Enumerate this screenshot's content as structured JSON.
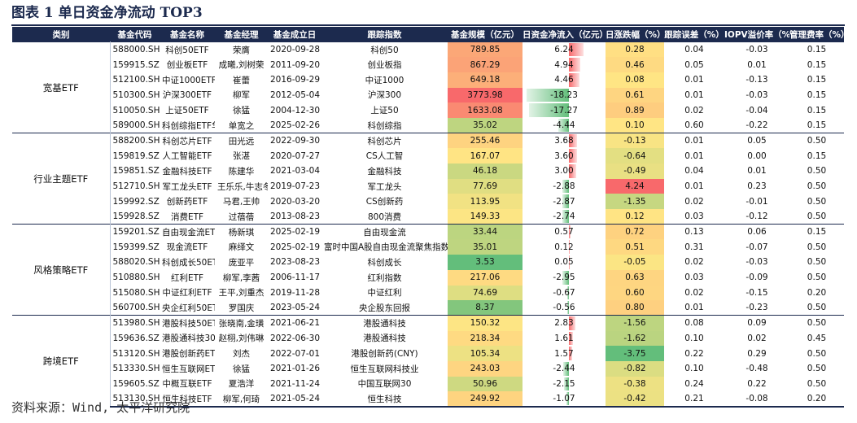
{
  "title": "图表 1  单日资金净流动 TOP3",
  "source": "资料来源：Wind, 太平洋研究院",
  "columns": [
    "类别",
    "基金代码",
    "基金名称",
    "基金经理",
    "基金成立日",
    "跟踪指数",
    "基金规模（亿元）",
    "日资金净流入（亿元）",
    "日涨跌幅（%）",
    "跟踪误差（%）",
    "IOPV溢价率（%）",
    "管理费率（%）"
  ],
  "colors": {
    "header_bg": "#1c2a4e",
    "flow_positive": "#f8696b",
    "flow_negative": "#63be7b"
  },
  "groups": [
    {
      "name": "宽基ETF",
      "rows": [
        {
          "code": "588000.SH",
          "name": "科创50ETF",
          "manager": "荣膺",
          "date": "2020-09-28",
          "index": "科创50",
          "size": "789.85",
          "flow": "6.24",
          "change": "0.28",
          "te": "0.04",
          "iopv": "-0.03",
          "fee": "0.15"
        },
        {
          "code": "159915.SZ",
          "name": "创业板ETF",
          "manager": "成曦,刘树荣",
          "date": "2011-09-20",
          "index": "创业板指",
          "size": "867.29",
          "flow": "4.94",
          "change": "0.46",
          "te": "0.05",
          "iopv": "0.01",
          "fee": "0.15"
        },
        {
          "code": "512100.SH",
          "name": "中证1000ETF",
          "manager": "崔蕾",
          "date": "2016-09-29",
          "index": "中证1000",
          "size": "649.18",
          "flow": "4.46",
          "change": "0.08",
          "te": "0.01",
          "iopv": "-0.13",
          "fee": "0.15"
        },
        {
          "code": "510300.SH",
          "name": "沪深300ETF",
          "manager": "柳军",
          "date": "2012-05-04",
          "index": "沪深300",
          "size": "3773.98",
          "flow": "-18.23",
          "change": "0.61",
          "te": "0.01",
          "iopv": "-0.03",
          "fee": "0.15"
        },
        {
          "code": "510050.SH",
          "name": "上证50ETF",
          "manager": "徐猛",
          "date": "2004-12-30",
          "index": "上证50",
          "size": "1633.08",
          "flow": "-17.27",
          "change": "0.89",
          "te": "0.02",
          "iopv": "-0.04",
          "fee": "0.15"
        },
        {
          "code": "589000.SH",
          "name": "科创综指ETF华夏",
          "manager": "单宽之",
          "date": "2025-02-26",
          "index": "科创综指",
          "size": "35.02",
          "flow": "-4.44",
          "change": "0.10",
          "te": "0.60",
          "iopv": "-0.22",
          "fee": "0.15"
        }
      ]
    },
    {
      "name": "行业主题ETF",
      "rows": [
        {
          "code": "588200.SH",
          "name": "科创芯片ETF",
          "manager": "田光远",
          "date": "2022-09-30",
          "index": "科创芯片",
          "size": "255.46",
          "flow": "3.68",
          "change": "-0.13",
          "te": "0.01",
          "iopv": "0.05",
          "fee": "0.50"
        },
        {
          "code": "159819.SZ",
          "name": "人工智能ETF",
          "manager": "张湛",
          "date": "2020-07-27",
          "index": "CS人工智",
          "size": "167.07",
          "flow": "3.60",
          "change": "-0.64",
          "te": "0.01",
          "iopv": "0.00",
          "fee": "0.15"
        },
        {
          "code": "159851.SZ",
          "name": "金融科技ETF",
          "manager": "陈建华",
          "date": "2021-03-04",
          "index": "金融科技",
          "size": "46.18",
          "flow": "3.00",
          "change": "-0.49",
          "te": "0.04",
          "iopv": "0.01",
          "fee": "0.50"
        },
        {
          "code": "512710.SH",
          "name": "军工龙头ETF",
          "manager": "王乐乐,牛志冬",
          "date": "2019-07-23",
          "index": "军工龙头",
          "size": "77.69",
          "flow": "-2.88",
          "change": "4.24",
          "te": "0.01",
          "iopv": "0.23",
          "fee": "0.50"
        },
        {
          "code": "159992.SZ",
          "name": "创新药ETF",
          "manager": "马君,王帅",
          "date": "2020-03-20",
          "index": "CS创新药",
          "size": "113.95",
          "flow": "-2.87",
          "change": "-1.35",
          "te": "0.02",
          "iopv": "-0.01",
          "fee": "0.50"
        },
        {
          "code": "159928.SZ",
          "name": "消费ETF",
          "manager": "过蓓蓓",
          "date": "2013-08-23",
          "index": "800消费",
          "size": "149.33",
          "flow": "-2.74",
          "change": "0.12",
          "te": "0.03",
          "iopv": "-0.12",
          "fee": "0.50"
        }
      ]
    },
    {
      "name": "风格策略ETF",
      "rows": [
        {
          "code": "159201.SZ",
          "name": "自由现金流ETF",
          "manager": "杨新琪",
          "date": "2025-02-19",
          "index": "自由现金流",
          "size": "33.44",
          "flow": "0.57",
          "change": "0.72",
          "te": "0.13",
          "iopv": "0.06",
          "fee": "0.15"
        },
        {
          "code": "159399.SZ",
          "name": "现金流ETF",
          "manager": "麻绎文",
          "date": "2025-02-19",
          "index": "富时中国A股自由现金流聚焦指数",
          "size": "35.01",
          "flow": "0.12",
          "change": "0.51",
          "te": "0.31",
          "iopv": "-0.07",
          "fee": "0.50"
        },
        {
          "code": "588020.SH",
          "name": "科创成长50ETF",
          "manager": "庞亚平",
          "date": "2023-08-23",
          "index": "科创成长",
          "size": "3.53",
          "flow": "0.05",
          "change": "-0.05",
          "te": "0.02",
          "iopv": "-0.03",
          "fee": "0.50"
        },
        {
          "code": "510880.SH",
          "name": "红利ETF",
          "manager": "柳军,李茜",
          "date": "2006-11-17",
          "index": "红利指数",
          "size": "217.06",
          "flow": "-2.95",
          "change": "0.63",
          "te": "0.03",
          "iopv": "-0.09",
          "fee": "0.50"
        },
        {
          "code": "515080.SH",
          "name": "中证红利ETF",
          "manager": "王平,刘重杰",
          "date": "2019-11-28",
          "index": "中证红利",
          "size": "74.69",
          "flow": "-0.67",
          "change": "0.60",
          "te": "0.02",
          "iopv": "-0.15",
          "fee": "0.20"
        },
        {
          "code": "560700.SH",
          "name": "央企红利50ETF",
          "manager": "罗国庆",
          "date": "2023-05-24",
          "index": "央企股东回报",
          "size": "8.37",
          "flow": "-0.56",
          "change": "0.80",
          "te": "0.01",
          "iopv": "-0.23",
          "fee": "0.50"
        }
      ]
    },
    {
      "name": "跨境ETF",
      "rows": [
        {
          "code": "513980.SH",
          "name": "港股科技50ETF",
          "manager": "张晓南,金璜",
          "date": "2021-06-21",
          "index": "港股通科技",
          "size": "150.32",
          "flow": "2.83",
          "change": "-1.56",
          "te": "0.08",
          "iopv": "0.09",
          "fee": "0.50"
        },
        {
          "code": "159636.SZ",
          "name": "港股通科技30ETF",
          "manager": "赵栩,刘伟琳",
          "date": "2022-06-30",
          "index": "港股通科技",
          "size": "218.34",
          "flow": "1.61",
          "change": "-1.62",
          "te": "0.10",
          "iopv": "0.02",
          "fee": "0.45"
        },
        {
          "code": "513120.SH",
          "name": "港股创新药ETF",
          "manager": "刘杰",
          "date": "2022-07-01",
          "index": "港股创新药(CNY)",
          "size": "105.34",
          "flow": "1.57",
          "change": "-3.75",
          "te": "0.22",
          "iopv": "0.29",
          "fee": "0.50"
        },
        {
          "code": "513330.SH",
          "name": "恒生互联网ETF",
          "manager": "徐猛",
          "date": "2021-01-26",
          "index": "恒生互联网科技业",
          "size": "243.03",
          "flow": "-2.44",
          "change": "-0.82",
          "te": "0.10",
          "iopv": "-0.48",
          "fee": "0.50"
        },
        {
          "code": "159605.SZ",
          "name": "中概互联ETF",
          "manager": "夏浩洋",
          "date": "2021-11-24",
          "index": "中国互联网30",
          "size": "50.96",
          "flow": "-2.15",
          "change": "-0.38",
          "te": "0.24",
          "iopv": "0.22",
          "fee": "0.50"
        },
        {
          "code": "513130.SH",
          "name": "恒生科技ETF",
          "manager": "柳军,何琦",
          "date": "2021-05-24",
          "index": "恒生科技",
          "size": "249.92",
          "flow": "-1.07",
          "change": "-0.42",
          "te": "0.21",
          "iopv": "-0.08",
          "fee": "0.20"
        }
      ]
    }
  ]
}
